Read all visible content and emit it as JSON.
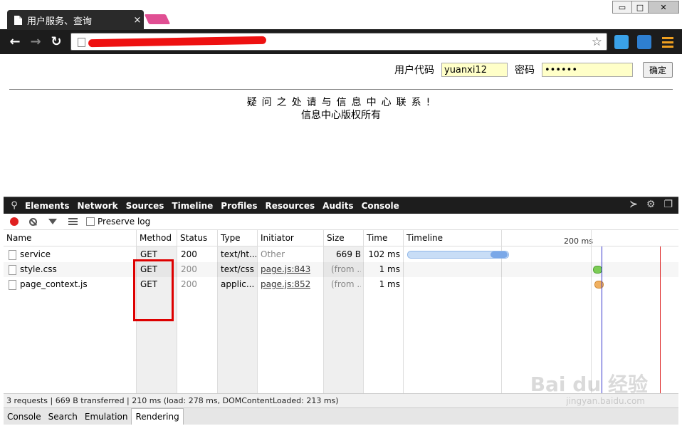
{
  "browser": {
    "tab_title": "用户服务、查询",
    "tab_close": "×",
    "url_text": "",
    "window_buttons": [
      "▭",
      "□",
      "✕"
    ]
  },
  "page": {
    "user_label": "用户代码",
    "user_value": "yuanxi12",
    "password_label": "密码",
    "password_value": "••••••",
    "ok_button": "确定",
    "contact_text": "疑问之处请与信息中心联系!",
    "copyright_text": "信息中心版权所有"
  },
  "devtools": {
    "tabs": [
      "Elements",
      "Network",
      "Sources",
      "Timeline",
      "Profiles",
      "Resources",
      "Audits",
      "Console"
    ],
    "preserve_log": "Preserve log",
    "columns": [
      "Name",
      "Method",
      "Status",
      "Type",
      "Initiator",
      "Size",
      "Time",
      "Timeline"
    ],
    "timeline_label": "200 ms",
    "rows": [
      {
        "name": "service",
        "method": "GET",
        "status": "200",
        "type": "text/ht...",
        "initiator": "Other",
        "size": "669 B",
        "time": "102 ms"
      },
      {
        "name": "style.css",
        "method": "GET",
        "status": "200",
        "type": "text/css",
        "initiator": "page.js:843",
        "size": "(from ...",
        "time": "1 ms"
      },
      {
        "name": "page_context.js",
        "method": "GET",
        "status": "200",
        "type": "applic...",
        "initiator": "page.js:852",
        "size": "(from ...",
        "time": "1 ms"
      }
    ],
    "status_bar": "3 requests | 669 B transferred | 210 ms (load: 278 ms, DOMContentLoaded: 213 ms)",
    "drawer_tabs": [
      "Console",
      "Search",
      "Emulation",
      "Rendering"
    ],
    "drawer_active": "Rendering"
  },
  "watermark": {
    "main": "Bai du 经验",
    "sub": "jingyan.baidu.com"
  }
}
